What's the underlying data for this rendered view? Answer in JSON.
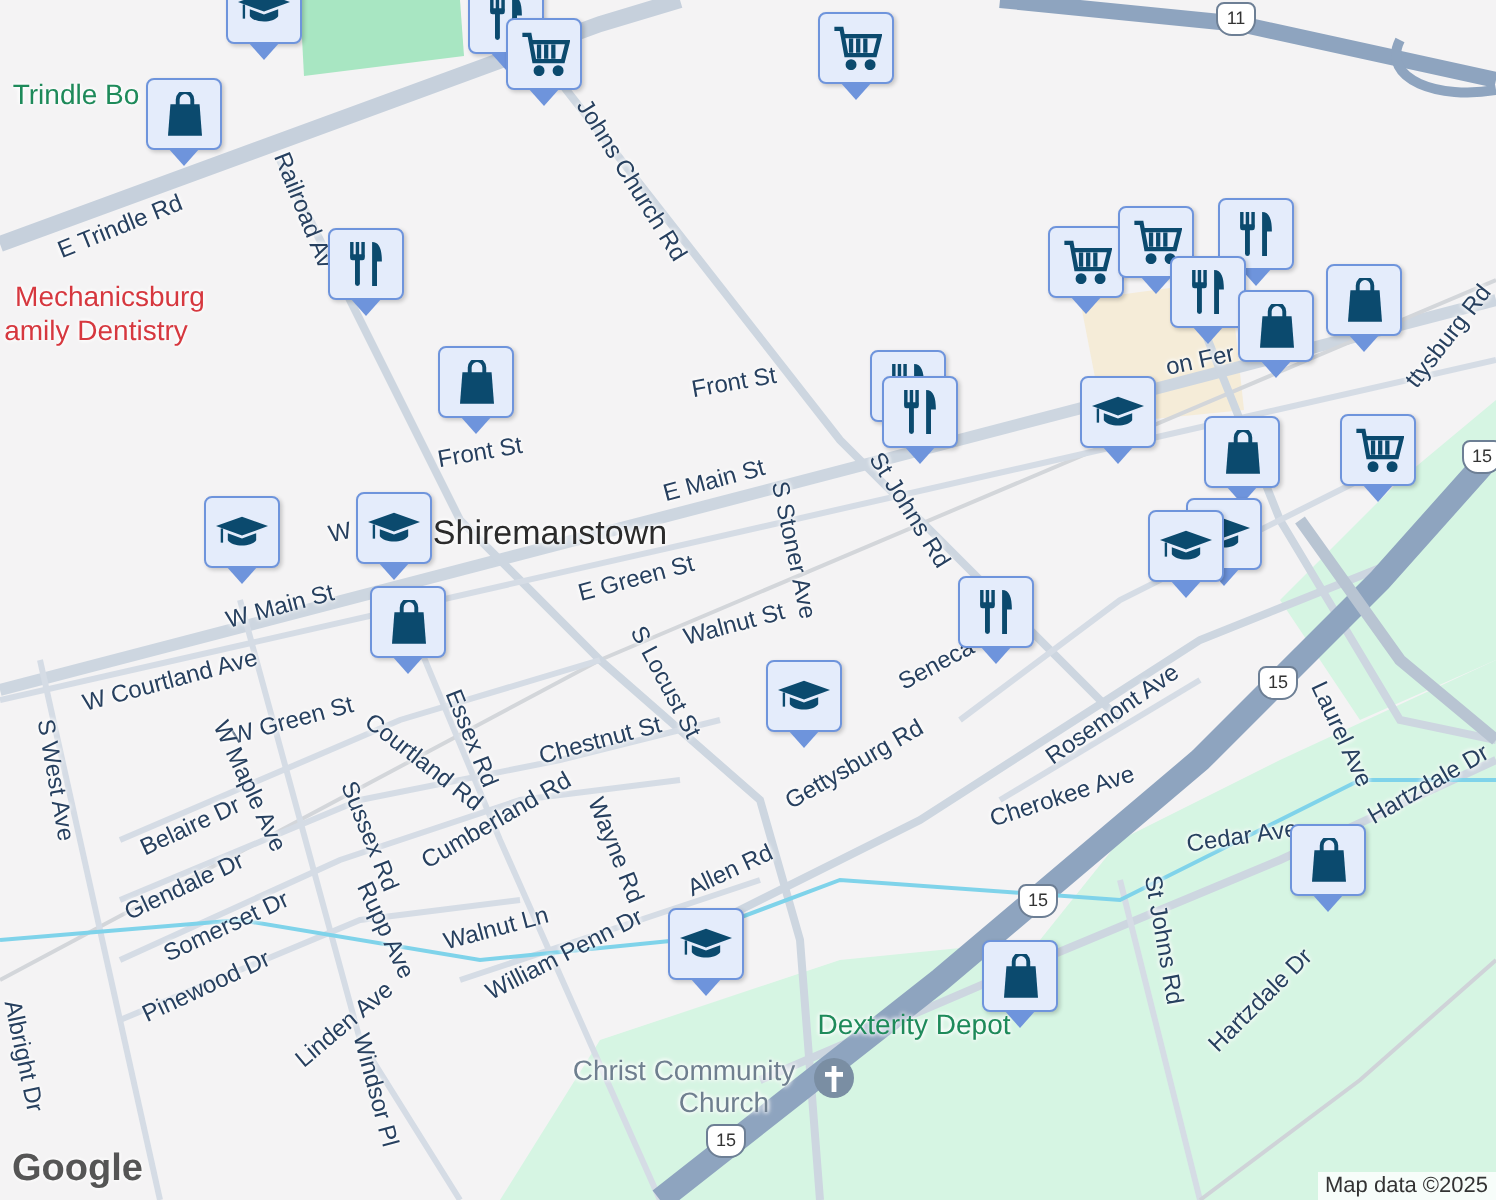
{
  "map": {
    "labels": [
      {
        "text": "Trindle Bo",
        "kind": "park"
      },
      {
        "text": "E Trindle Rd",
        "kind": "street"
      },
      {
        "text": "Railroad Av",
        "kind": "street"
      },
      {
        "text": "Johns Church Rd",
        "kind": "street"
      },
      {
        "text": "Mechanicsburg",
        "kind": "business"
      },
      {
        "text": "amily Dentistry",
        "kind": "business"
      },
      {
        "text": "Front St",
        "kind": "street"
      },
      {
        "text": "Front St",
        "kind": "street"
      },
      {
        "text": "E Main St",
        "kind": "street"
      },
      {
        "text": "W",
        "kind": "street"
      },
      {
        "text": "Shiremanstown",
        "kind": "town"
      },
      {
        "text": "E Green St",
        "kind": "street"
      },
      {
        "text": "S Stoner Ave",
        "kind": "street"
      },
      {
        "text": "St Johns Rd",
        "kind": "street"
      },
      {
        "text": "Walnut St",
        "kind": "street"
      },
      {
        "text": "Seneca",
        "kind": "street"
      },
      {
        "text": "W Main St",
        "kind": "street"
      },
      {
        "text": "W Courtland Ave",
        "kind": "street"
      },
      {
        "text": "W Green St",
        "kind": "street"
      },
      {
        "text": "S West Ave",
        "kind": "street"
      },
      {
        "text": "W Maple Ave",
        "kind": "street"
      },
      {
        "text": "Belaire Dr",
        "kind": "street"
      },
      {
        "text": "Glendale Dr",
        "kind": "street"
      },
      {
        "text": "Somerset Dr",
        "kind": "street"
      },
      {
        "text": "Pinewood Dr",
        "kind": "street"
      },
      {
        "text": "Albright Dr",
        "kind": "street"
      },
      {
        "text": "Essex Rd",
        "kind": "street"
      },
      {
        "text": "Courtland Rd",
        "kind": "street"
      },
      {
        "text": "Sussex Rd",
        "kind": "street"
      },
      {
        "text": "Rupp Ave",
        "kind": "street"
      },
      {
        "text": "Linden Ave",
        "kind": "street"
      },
      {
        "text": "Windsor Pl",
        "kind": "street"
      },
      {
        "text": "Cumberland Rd",
        "kind": "street"
      },
      {
        "text": "Wayne Rd",
        "kind": "street"
      },
      {
        "text": "Walnut Ln",
        "kind": "street"
      },
      {
        "text": "William Penn Dr",
        "kind": "street"
      },
      {
        "text": "Chestnut St",
        "kind": "street"
      },
      {
        "text": "S Locust St",
        "kind": "street"
      },
      {
        "text": "Allen Rd",
        "kind": "street"
      },
      {
        "text": "Gettysburg Rd",
        "kind": "street"
      },
      {
        "text": "Rosemont Ave",
        "kind": "street"
      },
      {
        "text": "Cherokee Ave",
        "kind": "street"
      },
      {
        "text": "Laurel Ave",
        "kind": "street"
      },
      {
        "text": "Hartzdale Dr",
        "kind": "street"
      },
      {
        "text": "Cedar Ave",
        "kind": "street"
      },
      {
        "text": "St Johns Rd",
        "kind": "street"
      },
      {
        "text": "Hartzdale Dr",
        "kind": "street"
      },
      {
        "text": "Dexterity Depot",
        "kind": "park"
      },
      {
        "text": "Christ Community",
        "kind": "place"
      },
      {
        "text": "Church",
        "kind": "place"
      },
      {
        "text": "on Fer",
        "kind": "street"
      },
      {
        "text": "ttysburg Rd",
        "kind": "street"
      }
    ],
    "route_shields": [
      {
        "text": "11"
      },
      {
        "text": "15"
      },
      {
        "text": "15"
      },
      {
        "text": "15"
      },
      {
        "text": "15"
      }
    ],
    "markers": [
      {
        "kind": "school"
      },
      {
        "kind": "restaurant"
      },
      {
        "kind": "grocery"
      },
      {
        "kind": "shop"
      },
      {
        "kind": "grocery"
      },
      {
        "kind": "restaurant"
      },
      {
        "kind": "shop"
      },
      {
        "kind": "school"
      },
      {
        "kind": "school"
      },
      {
        "kind": "shop"
      },
      {
        "kind": "restaurant"
      },
      {
        "kind": "restaurant"
      },
      {
        "kind": "school"
      },
      {
        "kind": "grocery"
      },
      {
        "kind": "grocery"
      },
      {
        "kind": "restaurant"
      },
      {
        "kind": "restaurant"
      },
      {
        "kind": "shop"
      },
      {
        "kind": "shop"
      },
      {
        "kind": "shop"
      },
      {
        "kind": "grocery"
      },
      {
        "kind": "school"
      },
      {
        "kind": "school"
      },
      {
        "kind": "restaurant"
      },
      {
        "kind": "school"
      },
      {
        "kind": "school"
      },
      {
        "kind": "shop"
      },
      {
        "kind": "shop"
      }
    ],
    "logo": "Google",
    "attribution": "Map data ©2025"
  }
}
